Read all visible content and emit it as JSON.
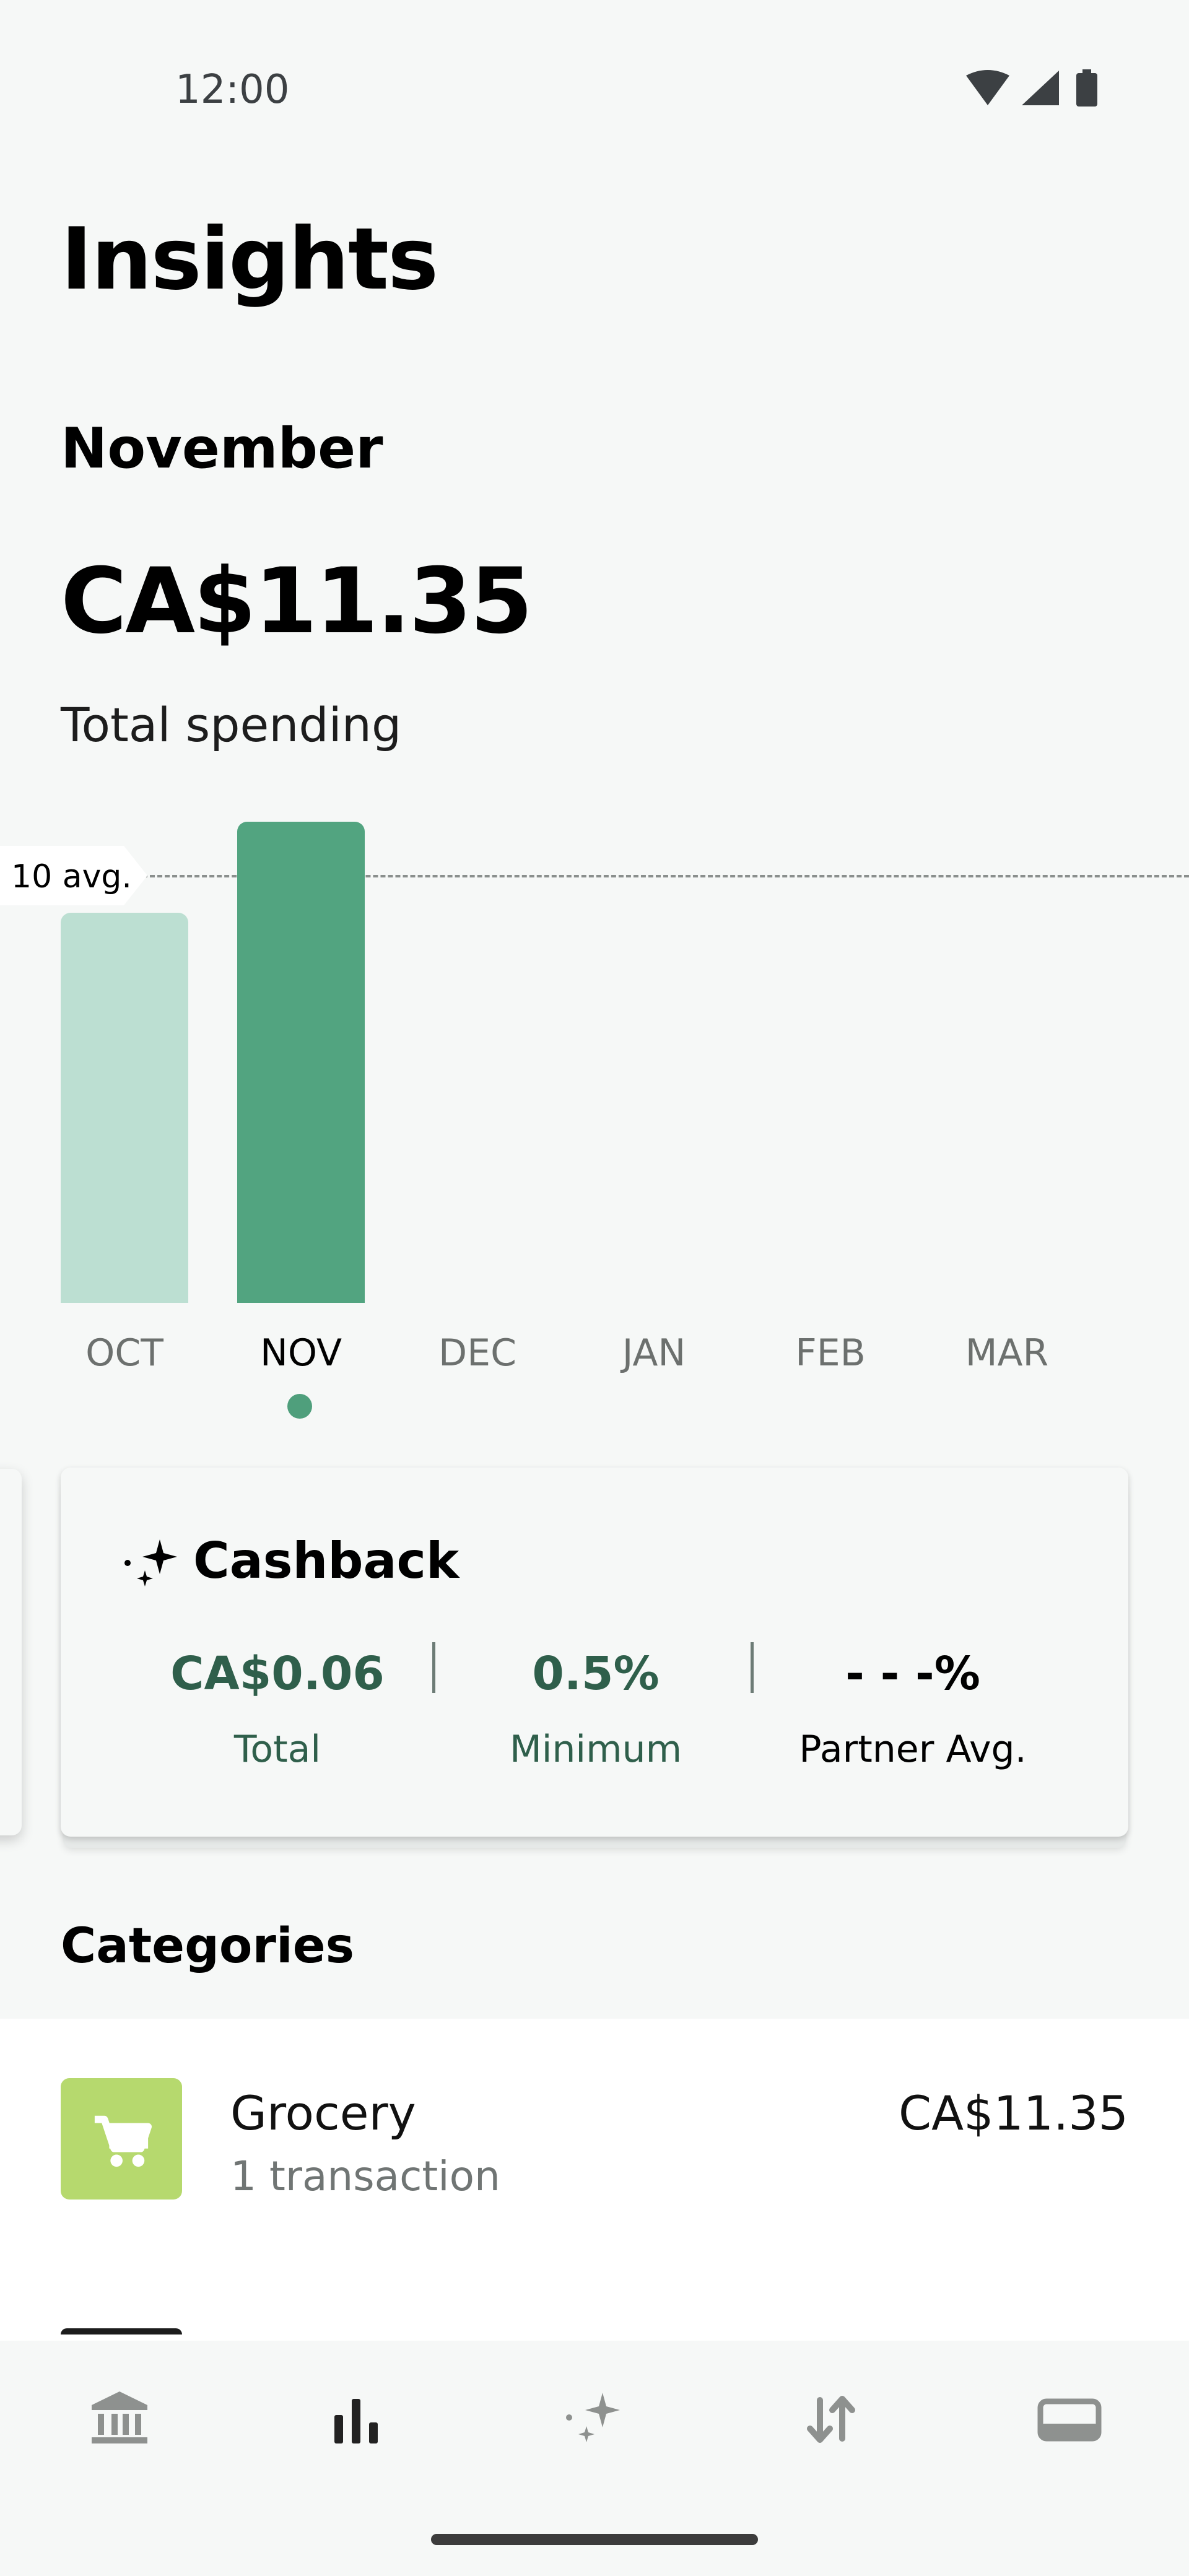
{
  "status_bar": {
    "time": "12:00"
  },
  "header": {
    "title": "Insights",
    "month": "November",
    "total_amount": "CA$11.35",
    "total_label": "Total spending"
  },
  "chart_data": {
    "type": "bar",
    "categories": [
      "OCT",
      "NOV",
      "DEC",
      "JAN",
      "FEB",
      "MAR"
    ],
    "values": [
      9.2,
      11.35,
      null,
      null,
      null,
      null
    ],
    "selected": "NOV",
    "average": 10,
    "average_label": "10 avg.",
    "grid": false,
    "title": "",
    "xlabel": "",
    "ylabel": ""
  },
  "cashback": {
    "title": "Cashback",
    "stats": [
      {
        "value": "CA$0.06",
        "label": "Total"
      },
      {
        "value": "0.5%",
        "label": "Minimum"
      },
      {
        "value": "- - -%",
        "label": "Partner Avg."
      }
    ]
  },
  "categories": {
    "title": "Categories",
    "items": [
      {
        "name": "Grocery",
        "count": "1 transaction",
        "amount": "CA$11.35",
        "icon": "cart-icon"
      }
    ]
  },
  "bottom_nav": {
    "items": [
      "bank-icon",
      "insights-bar-icon",
      "sparkle-icon",
      "transfer-icon",
      "card-icon"
    ],
    "active": "insights-bar-icon"
  },
  "colors": {
    "bar_selected": "#52a480",
    "bar_other": "#bcdfd2",
    "cashback_text": "#2f5f4b",
    "grocery_icon_bg": "#b6d96e"
  }
}
